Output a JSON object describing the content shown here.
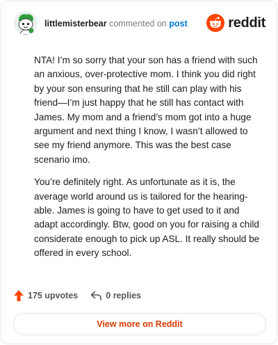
{
  "header": {
    "author": "littlemisterbear",
    "commented_on": "commented on",
    "post_link": "post",
    "brand_word": "reddit",
    "brand_color": "#ff4500"
  },
  "comment": {
    "paragraphs": [
      "NTA! I’m so sorry that your son has a friend with such an anxious, over-protective mom. I think you did right by your son ensuring that he still can play with his friend—I’m just happy that he still has contact with James. My mom and a friend’s mom got into a huge argument and next thing I know, I wasn’t allowed to see my friend anymore. This was the best case scenario imo.",
      "You’re definitely right. As unfortunate as it is, the average world around us is tailored for the hearing-able. James is going to have to get used to it and adapt accordingly. Btw, good on you for raising a child considerate enough to pick up ASL. It really should be offered in every school."
    ]
  },
  "footer": {
    "upvotes": "175 upvotes",
    "replies": "0 replies",
    "view_more": "View more on Reddit"
  },
  "icons": {
    "avatar": "snoo-avatar-icon",
    "logo": "reddit-snoo-icon",
    "upvote": "upvote-arrow-icon",
    "reply": "reply-arrow-icon"
  },
  "colors": {
    "link": "#0079d3",
    "accent": "#d93a00",
    "upvote": "#ff4500"
  }
}
